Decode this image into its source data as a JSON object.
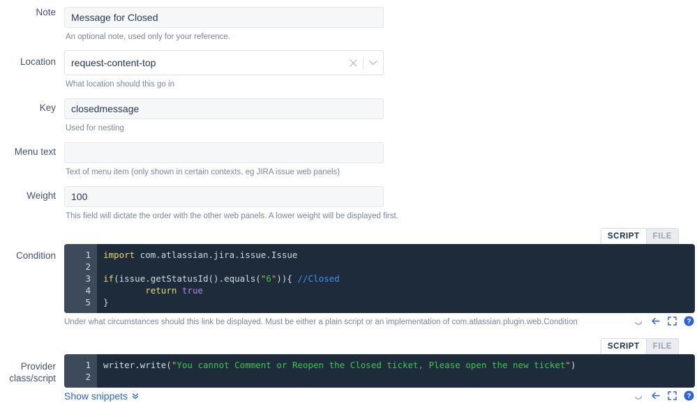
{
  "fields": {
    "note": {
      "label": "Note",
      "value": "Message for Closed",
      "placeholder": "",
      "help": "An optional note, used only for your reference."
    },
    "location": {
      "label": "Location",
      "value": "request-content-top",
      "help": "What location should this go in",
      "clear_icon": "close-icon",
      "dropdown_icon": "chevron-down-icon"
    },
    "key": {
      "label": "Key",
      "value": "closedmessage",
      "placeholder": "",
      "help": "Used for nesting"
    },
    "menu_text": {
      "label": "Menu text",
      "value": "",
      "placeholder": "",
      "help": "Text of menu item (only shown in certain contexts, eg JIRA issue web panels)"
    },
    "weight": {
      "label": "Weight",
      "value": "100",
      "placeholder": "",
      "help": "This field will dictate the order with the other web panels. A lower weight will be displayed first."
    }
  },
  "condition": {
    "label": "Condition",
    "tabs": [
      {
        "label": "SCRIPT",
        "active": true
      },
      {
        "label": "FILE",
        "active": false
      }
    ],
    "line_numbers": [
      "1",
      "2",
      "3",
      "4",
      "5"
    ],
    "code_lines": [
      [
        {
          "t": "import",
          "c": "kw"
        },
        {
          "t": " com.atlassian.jira.issue.Issue",
          "c": "plain"
        }
      ],
      [],
      [
        {
          "t": "if",
          "c": "kw"
        },
        {
          "t": "(issue.getStatusId().equals(",
          "c": "plain"
        },
        {
          "t": "\"",
          "c": "quote"
        },
        {
          "t": "6",
          "c": "str"
        },
        {
          "t": "\"",
          "c": "quote"
        },
        {
          "t": ")){ ",
          "c": "plain"
        },
        {
          "t": "//Closed",
          "c": "cmt"
        }
      ],
      [
        {
          "t": "        ",
          "c": "plain"
        },
        {
          "t": "return",
          "c": "kw"
        },
        {
          "t": " ",
          "c": "plain"
        },
        {
          "t": "true",
          "c": "bool"
        }
      ],
      [
        {
          "t": "}",
          "c": "plain"
        }
      ]
    ],
    "help": "Under what circumstances should this link be displayed. Must be either a plain script or an implementation of com.atlassian.plugin.web.Condition",
    "icons": [
      "loading-spinner-icon",
      "undo-arrow-icon",
      "fullscreen-icon",
      "help-icon"
    ]
  },
  "provider": {
    "label": "Provider class/script",
    "tabs": [
      {
        "label": "SCRIPT",
        "active": true
      },
      {
        "label": "FILE",
        "active": false
      }
    ],
    "line_numbers": [
      "1",
      "2"
    ],
    "code_lines": [
      [
        {
          "t": "writer.write(",
          "c": "plain"
        },
        {
          "t": "\"",
          "c": "quote"
        },
        {
          "t": "You cannot Comment or Reopen the Closed ticket, Please open the new ticket",
          "c": "str"
        },
        {
          "t": "\"",
          "c": "quote"
        },
        {
          "t": ")",
          "c": "plain"
        }
      ],
      []
    ],
    "icons": [
      "loading-spinner-icon",
      "undo-arrow-icon",
      "fullscreen-icon",
      "help-icon"
    ]
  },
  "snippets": {
    "label": "Show snippets",
    "icon": "double-chevron-down-icon"
  },
  "colors": {
    "link": "#2a62d8",
    "editor_bg": "#1d2b3a",
    "gutter_bg": "#3c4a5c",
    "keyword": "#ecd96f",
    "string": "#3ec84c",
    "comment": "#3f92f0",
    "boolean": "#b388e8",
    "label_text": "#42526e",
    "help_text": "#7a869a"
  }
}
